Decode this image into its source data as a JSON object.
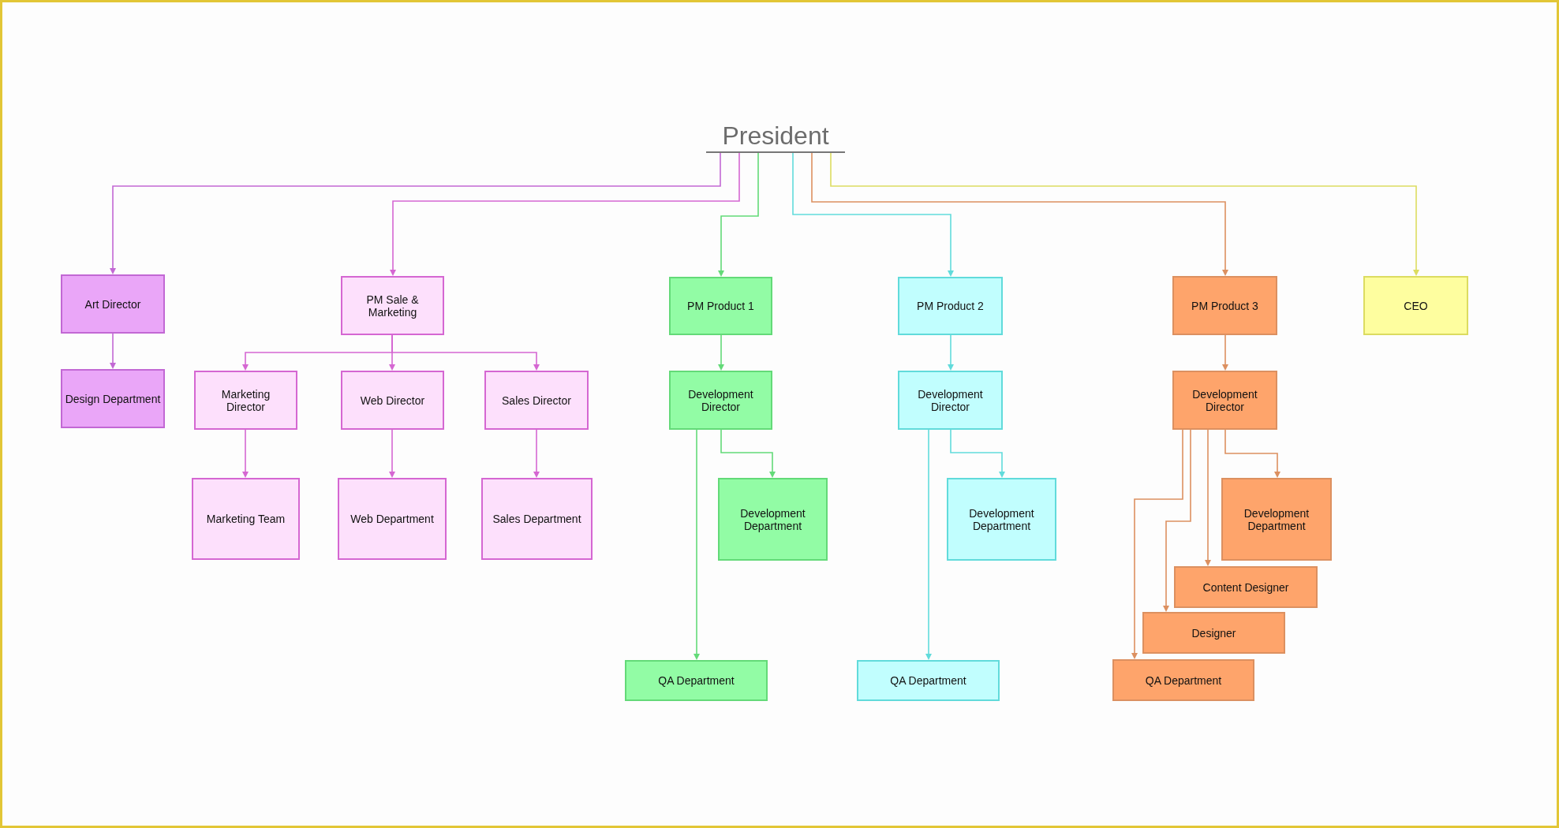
{
  "org_chart": {
    "root": {
      "label": "President",
      "children": [
        {
          "label": "Art Director",
          "color": "#eaa6f8",
          "children": [
            {
              "label": "Design Department"
            }
          ]
        },
        {
          "label": "PM Sale & Marketing",
          "color": "#fde0fc",
          "children": [
            {
              "label": "Marketing Director",
              "children": [
                {
                  "label": "Marketing Team"
                }
              ]
            },
            {
              "label": "Web Director",
              "children": [
                {
                  "label": "Web Department"
                }
              ]
            },
            {
              "label": "Sales Director",
              "children": [
                {
                  "label": "Sales Department"
                }
              ]
            }
          ]
        },
        {
          "label": "PM Product 1",
          "color": "#92fca5",
          "children": [
            {
              "label": "Development Director",
              "children": [
                {
                  "label": "Development Department"
                },
                {
                  "label": "QA Department"
                }
              ]
            }
          ]
        },
        {
          "label": "PM Product 2",
          "color": "#c1fefe",
          "children": [
            {
              "label": "Development Director",
              "children": [
                {
                  "label": "Development Department"
                },
                {
                  "label": "QA Department"
                }
              ]
            }
          ]
        },
        {
          "label": "PM Product 3",
          "color": "#fea46b",
          "children": [
            {
              "label": "Development Director",
              "children": [
                {
                  "label": "Development Department"
                },
                {
                  "label": "Content Designer"
                },
                {
                  "label": "Designer"
                },
                {
                  "label": "QA Department"
                }
              ]
            }
          ]
        },
        {
          "label": "CEO",
          "color": "#fefe9f"
        }
      ]
    }
  }
}
